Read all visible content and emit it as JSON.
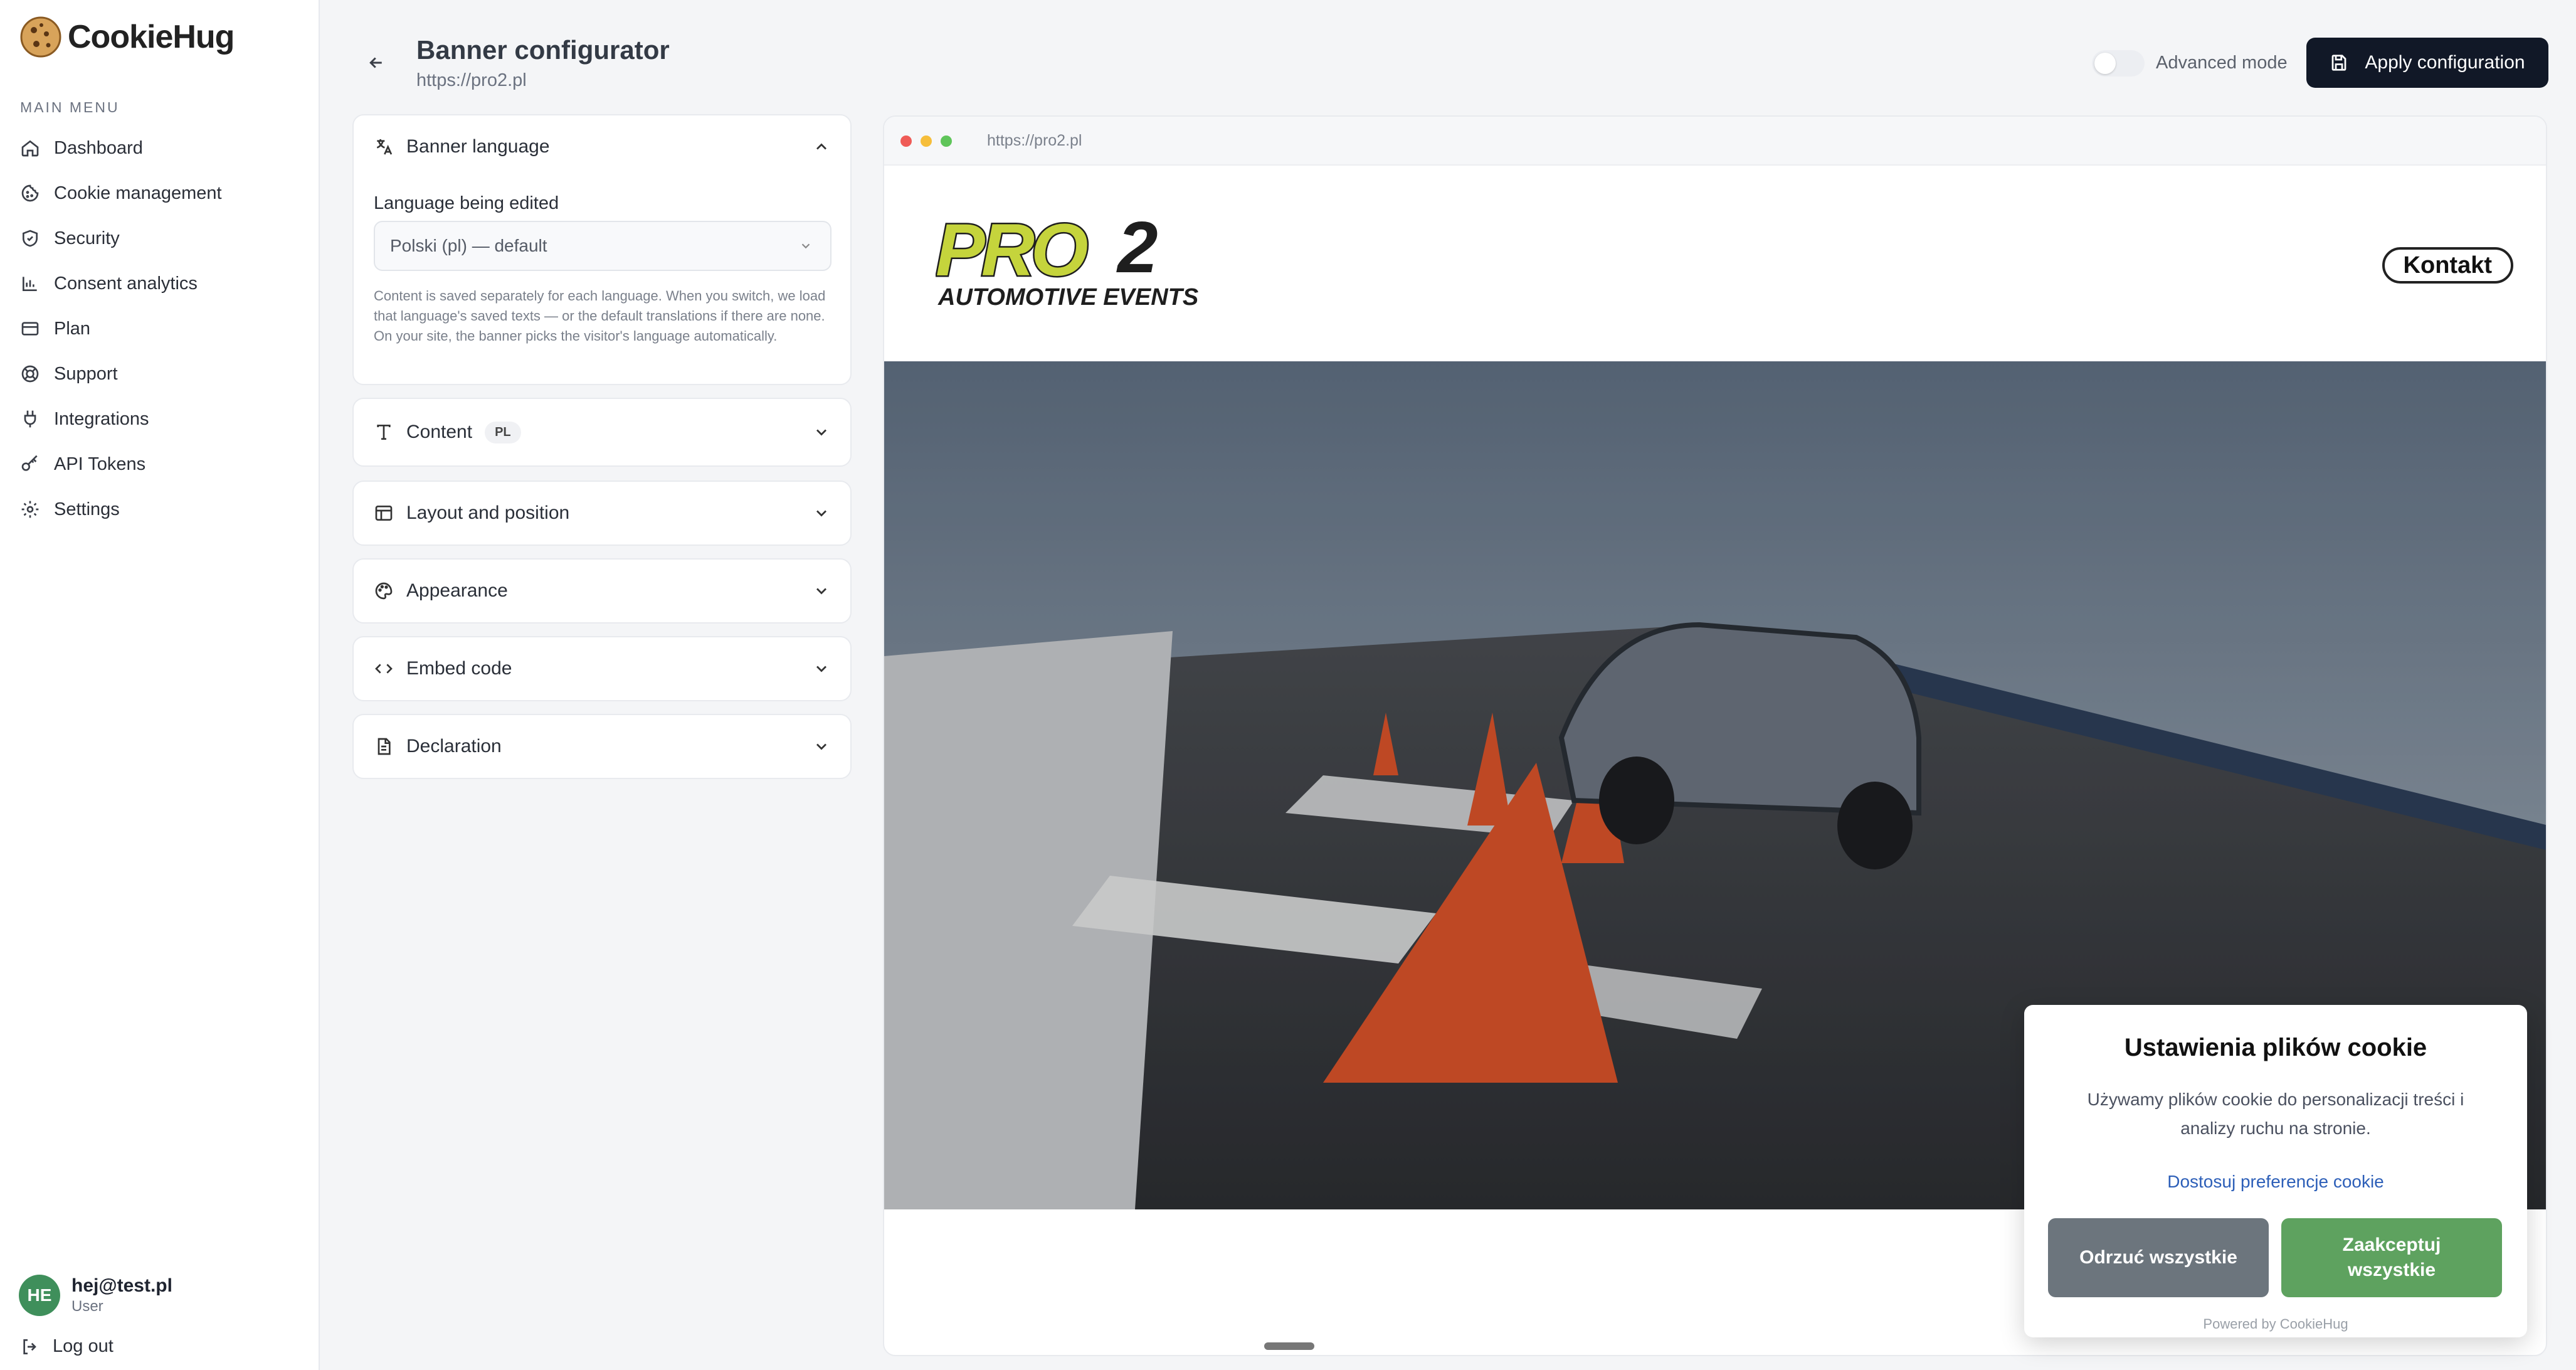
{
  "app": {
    "brand": "CookieHug"
  },
  "sidebar": {
    "caption": "MAIN MENU",
    "items": [
      {
        "label": "Dashboard",
        "icon": "home-icon"
      },
      {
        "label": "Cookie management",
        "icon": "cookie-icon"
      },
      {
        "label": "Security",
        "icon": "shield-icon"
      },
      {
        "label": "Consent analytics",
        "icon": "bar-chart-icon"
      },
      {
        "label": "Plan",
        "icon": "credit-card-icon"
      },
      {
        "label": "Support",
        "icon": "lifebuoy-icon"
      },
      {
        "label": "Integrations",
        "icon": "plug-icon"
      },
      {
        "label": "API Tokens",
        "icon": "key-icon"
      },
      {
        "label": "Settings",
        "icon": "gear-icon"
      }
    ],
    "user": {
      "initials": "HE",
      "email": "hej@test.pl",
      "role": "User"
    },
    "logout_label": "Log out"
  },
  "header": {
    "title": "Banner configurator",
    "subtitle": "https://pro2.pl",
    "advanced_mode_label": "Advanced mode",
    "advanced_mode_on": false,
    "apply_label": "Apply configuration"
  },
  "panel": {
    "language": {
      "title": "Banner language",
      "field_label": "Language being edited",
      "selected": "Polski (pl) — default",
      "help": "Content is saved separately for each language. When you switch, we load that language's saved texts — or the default translations if there are none. On your site, the banner picks the visitor's language automatically."
    },
    "content": {
      "title": "Content",
      "badge": "PL"
    },
    "layout": {
      "title": "Layout and position"
    },
    "appearance": {
      "title": "Appearance"
    },
    "embed": {
      "title": "Embed code"
    },
    "declaration": {
      "title": "Declaration"
    }
  },
  "preview": {
    "url": "https://pro2.pl",
    "site_logo_main": "PRO",
    "site_logo_num": "2",
    "site_logo_sub": "AUTOMOTIVE EVENTS",
    "nav_button": "Kontakt",
    "banner": {
      "title": "Ustawienia plików cookie",
      "text": "Używamy plików cookie do personalizacji treści i analizy ruchu na stronie.",
      "link": "Dostosuj preferencje cookie",
      "reject": "Odrzuć wszystkie",
      "accept": "Zaakceptuj wszystkie",
      "powered": "Powered by CookieHug"
    }
  },
  "colors": {
    "primary_button": "#111827",
    "reject_button": "#6c757d",
    "accept_button": "#5ea25f",
    "link": "#2d5fb8",
    "avatar": "#3f8f5b"
  }
}
